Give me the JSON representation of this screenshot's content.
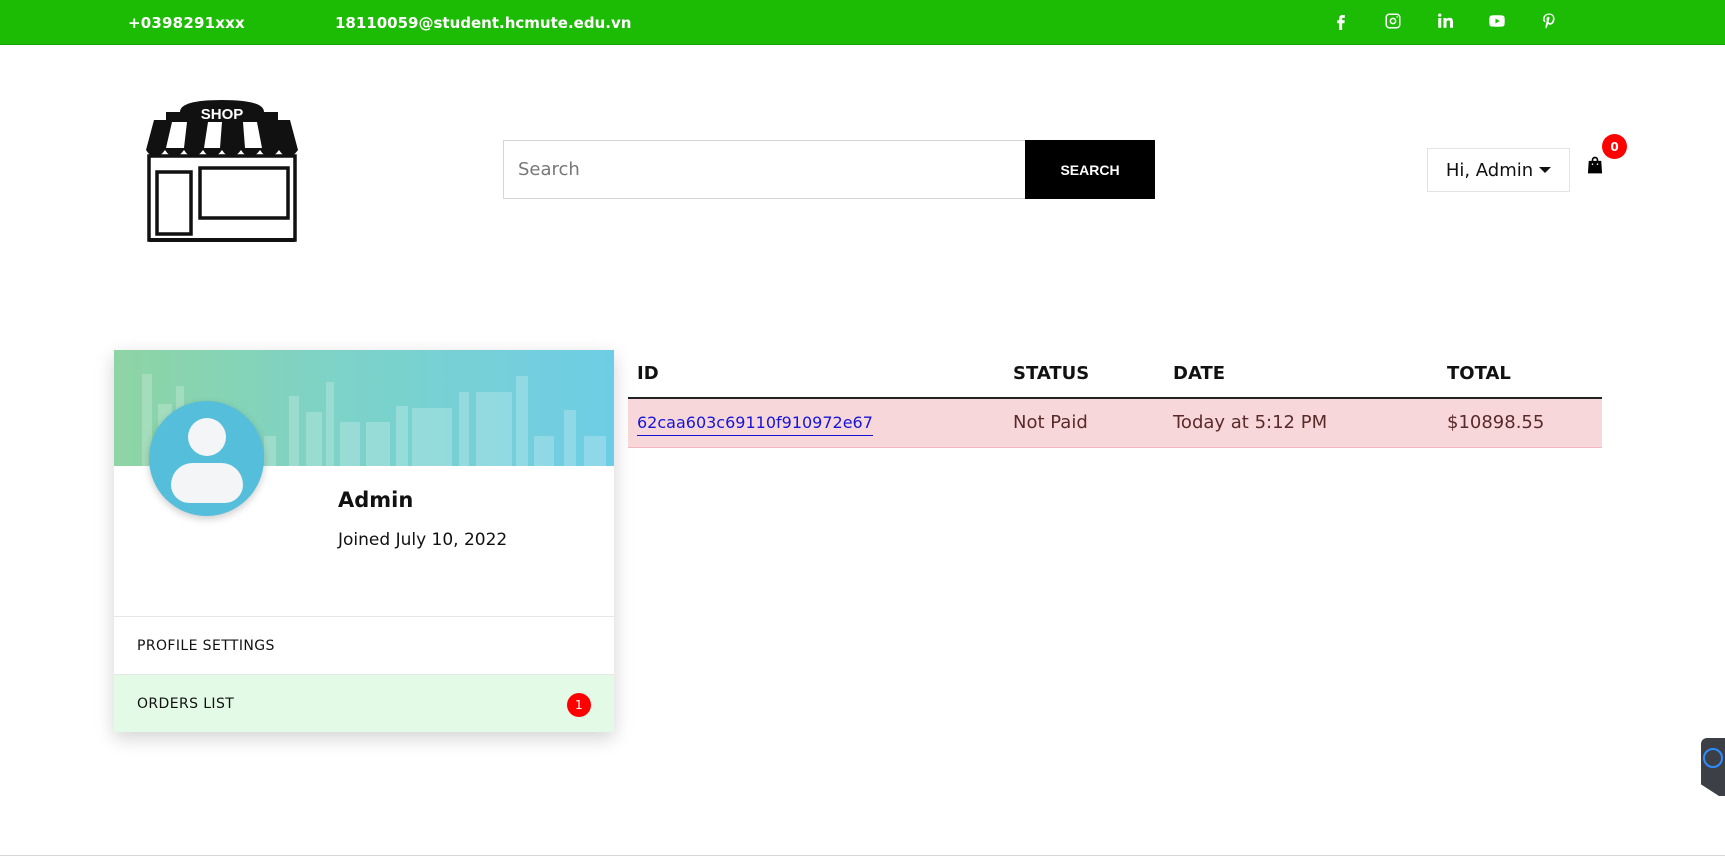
{
  "topbar": {
    "phone": "+0398291xxx",
    "email": "18110059@student.hcmute.edu.vn",
    "social": [
      "facebook-icon",
      "instagram-icon",
      "linkedin-icon",
      "youtube-icon",
      "pinterest-icon"
    ]
  },
  "logo": {
    "text": "SHOP"
  },
  "search": {
    "placeholder": "Search",
    "button_label": "SEARCH"
  },
  "user_menu": {
    "greeting": "Hi, Admin"
  },
  "cart": {
    "count": "0"
  },
  "profile": {
    "name": "Admin",
    "joined": "Joined July 10, 2022",
    "menu": {
      "profile_settings": "PROFILE SETTINGS",
      "orders_list": "ORDERS LIST",
      "orders_count": "1"
    }
  },
  "orders": {
    "headers": {
      "id": "ID",
      "status": "STATUS",
      "date": "DATE",
      "total": "TOTAL"
    },
    "rows": [
      {
        "id": "62caa603c69110f910972e67",
        "status": "Not Paid",
        "date": "Today at 5:12 PM",
        "total": "$10898.55"
      }
    ]
  },
  "colors": {
    "topbar": "#1cbb04",
    "badge": "#ff0000",
    "unpaid_row": "#f8d7da",
    "active_menu": "#e3fbe6"
  }
}
